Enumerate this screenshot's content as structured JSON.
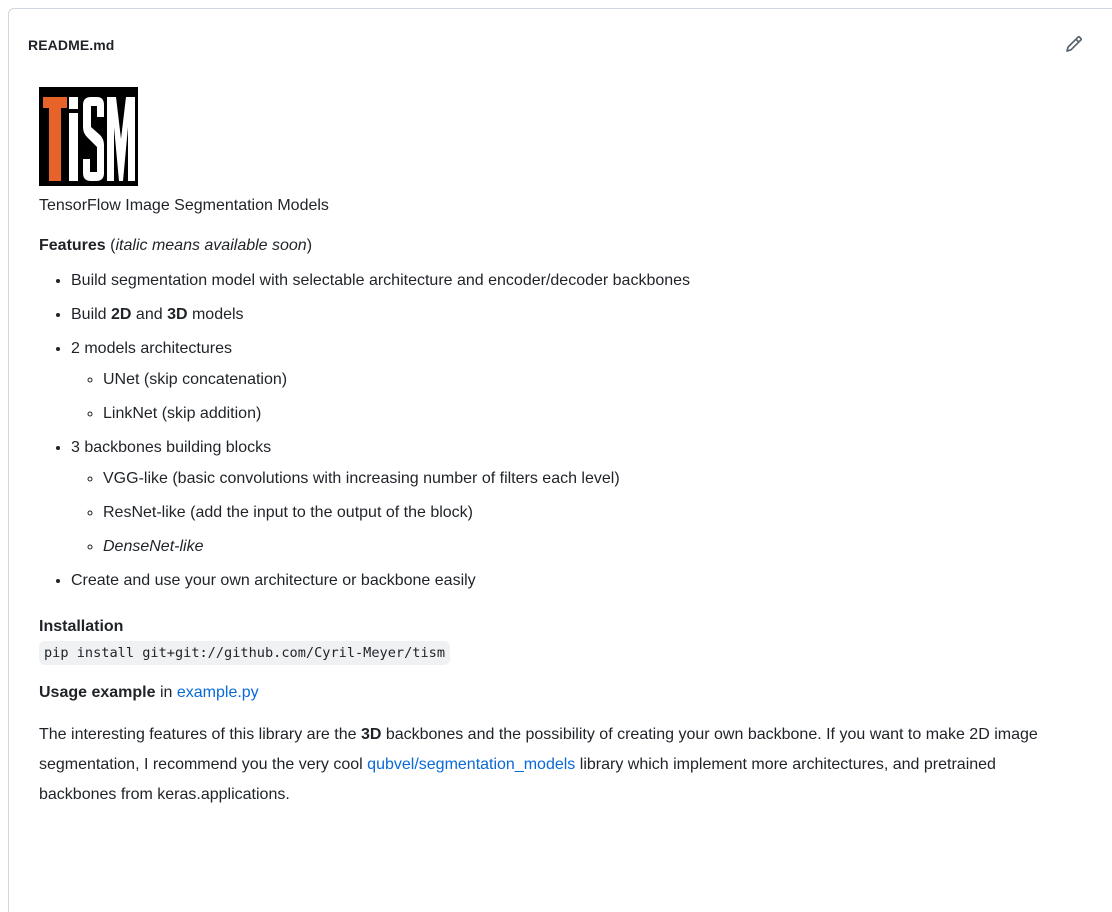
{
  "header": {
    "filename": "README.md",
    "edit_icon": "pencil-icon"
  },
  "logo": {
    "letters_white": "T",
    "letters_rest": "iSM",
    "accent_color": "#e8632a"
  },
  "content": {
    "subtitle": "TensorFlow Image Segmentation Models",
    "features_label": "Features",
    "features_note_open": " (",
    "features_note_italic": "italic means available soon",
    "features_note_close": ")",
    "items": {
      "i1": "Build segmentation model with selectable architecture and encoder/decoder backbones",
      "i2_pre": "Build ",
      "i2_b1": "2D",
      "i2_mid": " and ",
      "i2_b2": "3D",
      "i2_post": " models",
      "i3": "2 models architectures",
      "i3_sub1": "UNet (skip concatenation)",
      "i3_sub2": "LinkNet (skip addition)",
      "i4": "3 backbones building blocks",
      "i4_sub1": "VGG-like (basic convolutions with increasing number of filters each level)",
      "i4_sub2": "ResNet-like (add the input to the output of the block)",
      "i4_sub3": "DenseNet-like",
      "i5": "Create and use your own architecture or backbone easily"
    },
    "installation_title": "Installation",
    "install_command": "pip install git+git://github.com/Cyril-Meyer/tism",
    "usage_bold": "Usage example",
    "usage_in": " in ",
    "usage_link": "example.py",
    "para": {
      "p1": "The interesting features of this library are the ",
      "p_bold": "3D",
      "p2": " backbones and the possibility of creating your own backbone. If you want to make 2D image segmentation, I recommend you the very cool ",
      "link": "qubvel/segmentation_models",
      "p3": " library which implement more architectures, and pretrained backbones from keras.applications."
    }
  }
}
